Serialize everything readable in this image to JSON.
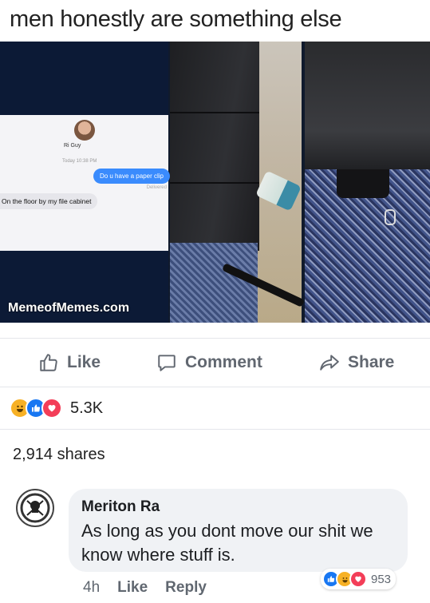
{
  "post": {
    "caption": "men honestly are something else",
    "image": {
      "chat": {
        "contact_name": "Ri Guy",
        "timestamp": "Today 10:38 PM",
        "outgoing_message": "Do u have a paper clip",
        "delivered": "Delivered",
        "incoming_message": "On the floor by my file cabinet"
      },
      "watermark": "MemeofMemes.com"
    },
    "actions": [
      {
        "label": "Like",
        "icon": "thumbs-up-icon"
      },
      {
        "label": "Comment",
        "icon": "comment-bubble-icon"
      },
      {
        "label": "Share",
        "icon": "share-arrow-icon"
      }
    ],
    "reactions": {
      "icons": [
        "haha-icon",
        "like-icon",
        "love-icon"
      ],
      "count": "5.3K"
    },
    "shares": "2,914 shares"
  },
  "comment": {
    "author": "Meriton Ra",
    "text": "As long as you dont move our shit we know where stuff is.",
    "time": "4h",
    "like_label": "Like",
    "reply_label": "Reply",
    "reactions": {
      "icons": [
        "like-icon",
        "haha-icon",
        "love-icon"
      ],
      "count": "953"
    }
  },
  "colors": {
    "like_blue": "#1877f2",
    "love_red": "#f33e58",
    "haha_yellow": "#f7b125",
    "muted_text": "#616770"
  }
}
